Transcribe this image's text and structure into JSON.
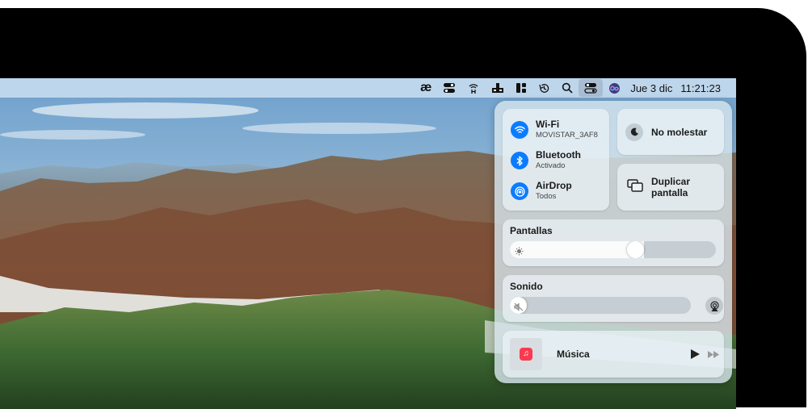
{
  "menubar": {
    "items": [
      {
        "icon": "ae-app-icon"
      },
      {
        "icon": "toggle-switch-icon"
      },
      {
        "icon": "hotspot-icon"
      },
      {
        "icon": "dock-icon"
      },
      {
        "icon": "window-layout-icon"
      },
      {
        "icon": "time-machine-icon"
      },
      {
        "icon": "search-icon"
      },
      {
        "icon": "control-center-icon",
        "active": true
      },
      {
        "icon": "siri-icon"
      }
    ],
    "ae_glyph": "æ",
    "date": "Jue 3 dic",
    "time": "11:21:23"
  },
  "control_center": {
    "wifi": {
      "title": "Wi-Fi",
      "subtitle": "MOVISTAR_3AF8",
      "icon": "wifi-icon"
    },
    "bluetooth": {
      "title": "Bluetooth",
      "subtitle": "Activado",
      "icon": "bluetooth-icon"
    },
    "airdrop": {
      "title": "AirDrop",
      "subtitle": "Todos",
      "icon": "airdrop-icon"
    },
    "do_not_disturb": {
      "label": "No molestar",
      "icon": "moon-icon"
    },
    "screen_mirroring": {
      "label": "Duplicar pantalla",
      "icon": "screen-mirroring-icon"
    },
    "display": {
      "title": "Pantallas",
      "brightness": 0.62,
      "icon": "sun-icon"
    },
    "sound": {
      "title": "Sonido",
      "volume": 0.0,
      "icon": "speaker-muted-icon"
    },
    "now_playing": {
      "label": "Música",
      "icon": "music-note-icon"
    }
  },
  "colors": {
    "accent": "#0a7cff",
    "music_app": "#fa3a4f"
  }
}
